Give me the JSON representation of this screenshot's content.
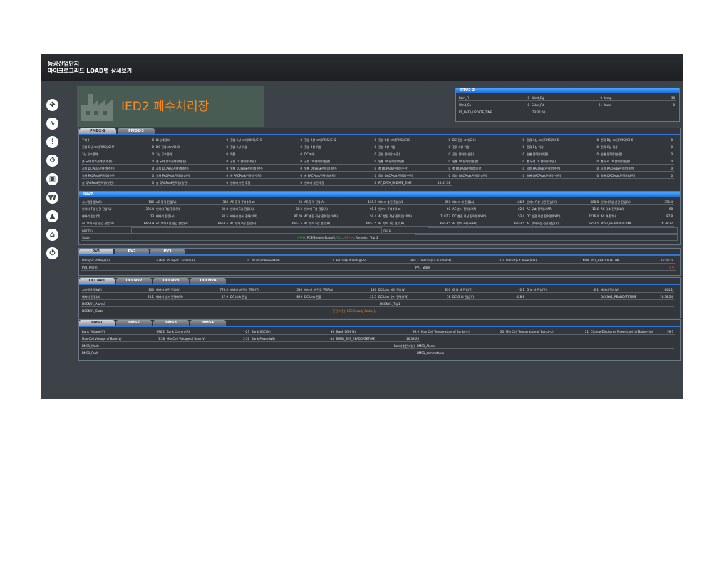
{
  "header": {
    "line1": "농공산업단지",
    "line2": "마이크로그리드 LOAD별 상세보기"
  },
  "sidebar_icons": [
    "gamepad-icon",
    "chart-line-icon",
    "sliders-icon",
    "gear-icon",
    "monitor-icon",
    "won-currency-icon",
    "chart-bar-icon",
    "factory-icon",
    "power-icon"
  ],
  "hero": {
    "title": "IED2 폐수처리장"
  },
  "rtu": {
    "title": "RTU2-2",
    "rows": [
      [
        {
          "l": "Rain_Fl",
          "v": "0"
        },
        {
          "l": "Wind_Dg",
          "v": "0"
        },
        {
          "l": "temp",
          "v": "38"
        }
      ],
      [
        {
          "l": "Wind_Sp",
          "v": "0"
        },
        {
          "l": "Solar_Rd",
          "v": "21"
        },
        {
          "l": "humi",
          "v": "0"
        }
      ],
      [
        {
          "l": "RT_DATA_UPDATE_TIME",
          "v": "13:22:00"
        }
      ]
    ]
  },
  "pmd": {
    "tabs": [
      "PMD2-1",
      "PMD2-3"
    ],
    "rows": [
      [
        {
          "l": "주파수",
          "v": "0"
        },
        {
          "l": "Di상태정보",
          "v": "0"
        },
        {
          "l": "전압 A상 크기(RMS)/CH1",
          "v": "0"
        },
        {
          "l": "전압 B상 크기(RMS)/CH2",
          "v": "0"
        },
        {
          "l": "전압 C상 크기(RMS)/CH3",
          "v": "0"
        },
        {
          "l": "DC 전압 크기/CH4",
          "v": "0"
        },
        {
          "l": "전류 A상 크기(RMS)/CH5",
          "v": "0"
        },
        {
          "l": "전류 B상 크기(RMS)/CH6",
          "v": "0"
        }
      ],
      [
        {
          "l": "전류 C상 크기(RMS)/CH7",
          "v": "0"
        },
        {
          "l": "DC 전류 크기/CH8",
          "v": "0"
        },
        {
          "l": "전압 A상 위상",
          "v": "0"
        },
        {
          "l": "전압 B상 위상",
          "v": "0"
        },
        {
          "l": "전압 C상 위상",
          "v": "0"
        },
        {
          "l": "전류 A상 위상",
          "v": "0"
        },
        {
          "l": "전류 B상 위상",
          "v": "0"
        },
        {
          "l": "전류 C상 위상",
          "v": "0"
        }
      ],
      [
        {
          "l": "3상 유효전력",
          "v": "0"
        },
        {
          "l": "3상 무효전력",
          "v": "0"
        },
        {
          "l": "역률",
          "v": "0"
        },
        {
          "l": "DC 파워",
          "v": "0"
        },
        {
          "l": "공칭 전력량(수전)",
          "v": "0"
        },
        {
          "l": "공칭 전력량(송전)",
          "v": "0"
        },
        {
          "l": "일별 전력량(수전)",
          "v": "0"
        },
        {
          "l": "일별 전력량(송전)",
          "v": "0"
        }
      ],
      [
        {
          "l": "총 누적 유효전력량(수전)",
          "v": "0"
        },
        {
          "l": "총 누적 유효전력량(송전)",
          "v": "0"
        },
        {
          "l": "공칭 DC전력량(수전)",
          "v": "0"
        },
        {
          "l": "공칭 DC전력량(송전)",
          "v": "0"
        },
        {
          "l": "일별 DC전력량(수전)",
          "v": "0"
        },
        {
          "l": "일별 DC전력량(송전)",
          "v": "0"
        },
        {
          "l": "총 누적 DC전력량(수전)",
          "v": "0"
        },
        {
          "l": "총 누적 DC전력량(송전)",
          "v": "0"
        }
      ],
      [
        {
          "l": "공칭 DCPeak전력량(수전)",
          "v": "0"
        },
        {
          "l": "공칭 DCPeak전력량(송전)",
          "v": "0"
        },
        {
          "l": "일별 DCPeak전력량(수전)",
          "v": "0"
        },
        {
          "l": "일별 DCPeak전력량(송전)",
          "v": "0"
        },
        {
          "l": "총 DCPeak전력량(수전)",
          "v": "0"
        },
        {
          "l": "총 DCPeak전력량(송전)",
          "v": "0"
        },
        {
          "l": "공칭 PACPeak전력량(수전)",
          "v": "0"
        },
        {
          "l": "공칭 PACPeak전력량(송전)",
          "v": "0"
        }
      ],
      [
        {
          "l": "일별 PACPeak전력량(수전)",
          "v": "0"
        },
        {
          "l": "일별 PACPeak전력량(송전)",
          "v": "0"
        },
        {
          "l": "총 PACPeak전력량(수전)",
          "v": "0"
        },
        {
          "l": "총 PACPeak전력량(송전)",
          "v": "0"
        },
        {
          "l": "공칭 QACPeak전력량(수전)",
          "v": "0"
        },
        {
          "l": "공칭 QACPeak전력량(송전)",
          "v": "0"
        },
        {
          "l": "일별 QACPeak전력량(수전)",
          "v": "0"
        },
        {
          "l": "일별 QACPeak전력량(송전)",
          "v": "0"
        }
      ],
      [
        {
          "l": "총 QACPeak전력량(수전)",
          "v": "0"
        },
        {
          "l": "총 QACPeak전력량(송전)",
          "v": "0"
        },
        {
          "l": "인버터 수전 후열",
          "v": "0"
        },
        {
          "l": "인버터 송전 후열",
          "v": "0"
        },
        {
          "l": "RT_DATA_UPDATE_TIME",
          "v": "16:47:38"
        }
      ]
    ]
  },
  "inv": {
    "title": "INV2",
    "rows": [
      [
        {
          "l": "시스템용량(kW)",
          "v": "100"
        },
        {
          "l": "AC 정격 전압(V)",
          "v": "380"
        },
        {
          "l": "AC 정격 주파수(Hz)",
          "v": "60"
        },
        {
          "l": "AC 정격 전류(A)",
          "v": "151.9"
        },
        {
          "l": "배터리 충전 전압(V)",
          "v": "850"
        },
        {
          "l": "배터리 과 전류(A)",
          "v": "166.5"
        },
        {
          "l": "인버터 R상 선간 전압(V)",
          "v": "388.8"
        },
        {
          "l": "인버터 S상 선간 전압(V)",
          "v": "391.4"
        }
      ],
      [
        {
          "l": "인버터 T상 선간 전압(V)",
          "v": "396.4"
        },
        {
          "l": "인버터 R상 전류(A)",
          "v": "89.8"
        },
        {
          "l": "인버터 S상 전류(A)",
          "v": "88.2"
        },
        {
          "l": "인버터 T상 전류(A)",
          "v": "91.1"
        },
        {
          "l": "인버터 주파수(Hz)",
          "v": "60"
        },
        {
          "l": "AC 순시 전력(kVA)",
          "v": "62.8"
        },
        {
          "l": "AC 무효 전력(kVAR)",
          "v": "11.6"
        },
        {
          "l": "AC 유효 전력(kW)",
          "v": "98"
        }
      ],
      [
        {
          "l": "배터리 전압(V)",
          "v": "23"
        },
        {
          "l": "배터리 전류(A)",
          "v": "30.5"
        },
        {
          "l": "배터리 순시 전력(kW)",
          "v": "87.09"
        },
        {
          "l": "AC 충전 적산 전력량(kWh)",
          "v": "50.4"
        },
        {
          "l": "AC 방전 적산 전력량(kWh)",
          "v": "7187.7"
        },
        {
          "l": "DC 충전 적산 전력량(kWh)",
          "v": "53.4"
        },
        {
          "l": "DC 방전 적산 전력량(kWh)",
          "v": "7216.4"
        },
        {
          "l": "AC 역률(%)",
          "v": "87.8"
        }
      ],
      [
        {
          "l": "AC 부하 S상 선간 전압(V)",
          "v": "6653.9"
        },
        {
          "l": "AC 부하 T상 선간 전압(V)",
          "v": "6653.5"
        },
        {
          "l": "AC 부하 R상 전류(A)",
          "v": "6653.5"
        },
        {
          "l": "AC 부하 S상 전류(A)",
          "v": "6653.5"
        },
        {
          "l": "AC 부하 T상 전류(A)",
          "v": "6653.5"
        },
        {
          "l": "AC 부하 주파수(Hz)",
          "v": "6653.5"
        },
        {
          "l": "AC 부하 R상 선간 전압(V)",
          "v": "6653.5"
        },
        {
          "l": "PCS1_READDATETIME",
          "v": "16:38:22"
        }
      ]
    ],
    "alarm_label": "Alarm_1",
    "trip1": "Trip_1",
    "state_label": "State",
    "trip2": "Trip_2",
    "state_parts": [
      {
        "t": "운전중",
        "c": "grn"
      },
      {
        "t": ", PCS[Steady Status], ",
        "c": ""
      },
      {
        "t": "정상",
        "c": "grn"
      },
      {
        "t": ", ",
        "c": ""
      },
      {
        "t": "계통연계",
        "c": "red"
      },
      {
        "t": ", Remote,",
        "c": ""
      }
    ]
  },
  "pv": {
    "tabs": [
      "PV1",
      "PV2",
      "PV3"
    ],
    "row1": [
      {
        "l": "PV Input Voltage(V)",
        "v": "526.6"
      },
      {
        "l": "PV Input Current(A)",
        "v": "0"
      },
      {
        "l": "PV Input Power(kW)",
        "v": "2"
      },
      {
        "l": "PV Output Voltage(V)",
        "v": "831.1"
      },
      {
        "l": "PV Output Current(A)",
        "v": "0.2"
      },
      {
        "l": "PV Output Power(kW)",
        "v": "NaN"
      },
      {
        "l": "PV1_READDATETIME",
        "v": "16:59:29"
      }
    ],
    "alarm": "PV1_Alarm",
    "state": "PV1_State",
    "state_val": "정지"
  },
  "dccnv": {
    "tabs": [
      "DCCNV1",
      "DCCNV2",
      "DCCNV3",
      "DCCNV4"
    ],
    "rows": [
      [
        {
          "l": "시스템용량(kW)",
          "v": "100"
        },
        {
          "l": "배터리 충전 전압(V)",
          "v": "776.6"
        },
        {
          "l": "배터리 과 전압 TRIP(V)",
          "v": "595"
        },
        {
          "l": "배터리 과 전류 TRIP(A)",
          "v": "180"
        },
        {
          "l": "DC Link 설정 전압(V)",
          "v": "830"
        },
        {
          "l": "Grid 계 전압(V)",
          "v": "-0.1"
        },
        {
          "l": "Grid 과 전압(V)",
          "v": "-0.1"
        },
        {
          "l": "배터리 전압(V)",
          "v": "604.1"
        }
      ],
      [
        {
          "l": "배터리 전류(A)",
          "v": "26.1"
        },
        {
          "l": "배터리 순시 전력(kW)",
          "v": "17.9"
        },
        {
          "l": "DC Link 전압",
          "v": "829"
        },
        {
          "l": "DC Link 전류",
          "v": "21.5"
        },
        {
          "l": "DC Link 순시 전력(kW)",
          "v": "18"
        },
        {
          "l": "DC Grid 전압(V)",
          "v": "828.8"
        },
        {
          "l": "",
          "v": ""
        },
        {
          "l": "DCCNV1_READDATETIME",
          "v": "16:38:24"
        }
      ]
    ],
    "alarm": "DCCNV1_Alarm1",
    "trip": "DCCNV1_Trip1",
    "state": "DCCNV1_State",
    "state_val": "운전(가동), PCS[Steady Status],"
  },
  "bms": {
    "tabs": [
      "BMS1",
      "BMS2",
      "BMS3",
      "BMS4"
    ],
    "rows": [
      [
        {
          "l": "Bank Voltage(V)",
          "v": "696.2"
        },
        {
          "l": "Bank Current(A)",
          "v": "-23"
        },
        {
          "l": "Bank SOC(%)",
          "v": "36"
        },
        {
          "l": "Bank SOH(%)",
          "v": "99.9"
        },
        {
          "l": "Max Cell Temperature of Bank(℃)",
          "v": "23"
        },
        {
          "l": "Min Cell Temperature of Bank(℃)",
          "v": "21"
        },
        {
          "l": "Charge/Discharge Power Limit of Battery(A)",
          "v": "59.3"
        }
      ],
      [
        {
          "l": "Max Cell Voltage of Bank(V)",
          "v": "3.58"
        },
        {
          "l": "Min Cell Voltage of Bank(V)",
          "v": "3.56"
        },
        {
          "l": "Bank Power(kW)",
          "v": "-15"
        },
        {
          "l": "BMS1_SYS_READDATETIME",
          "v": "16:39:26"
        }
      ]
    ],
    "mode": "BMS1_Mode",
    "mode_val": "Bank(충전 가능)",
    "alarm": "BMS1_Alarm",
    "fault": "BMS1_Fault",
    "comm": "BMS1_commstatus"
  }
}
